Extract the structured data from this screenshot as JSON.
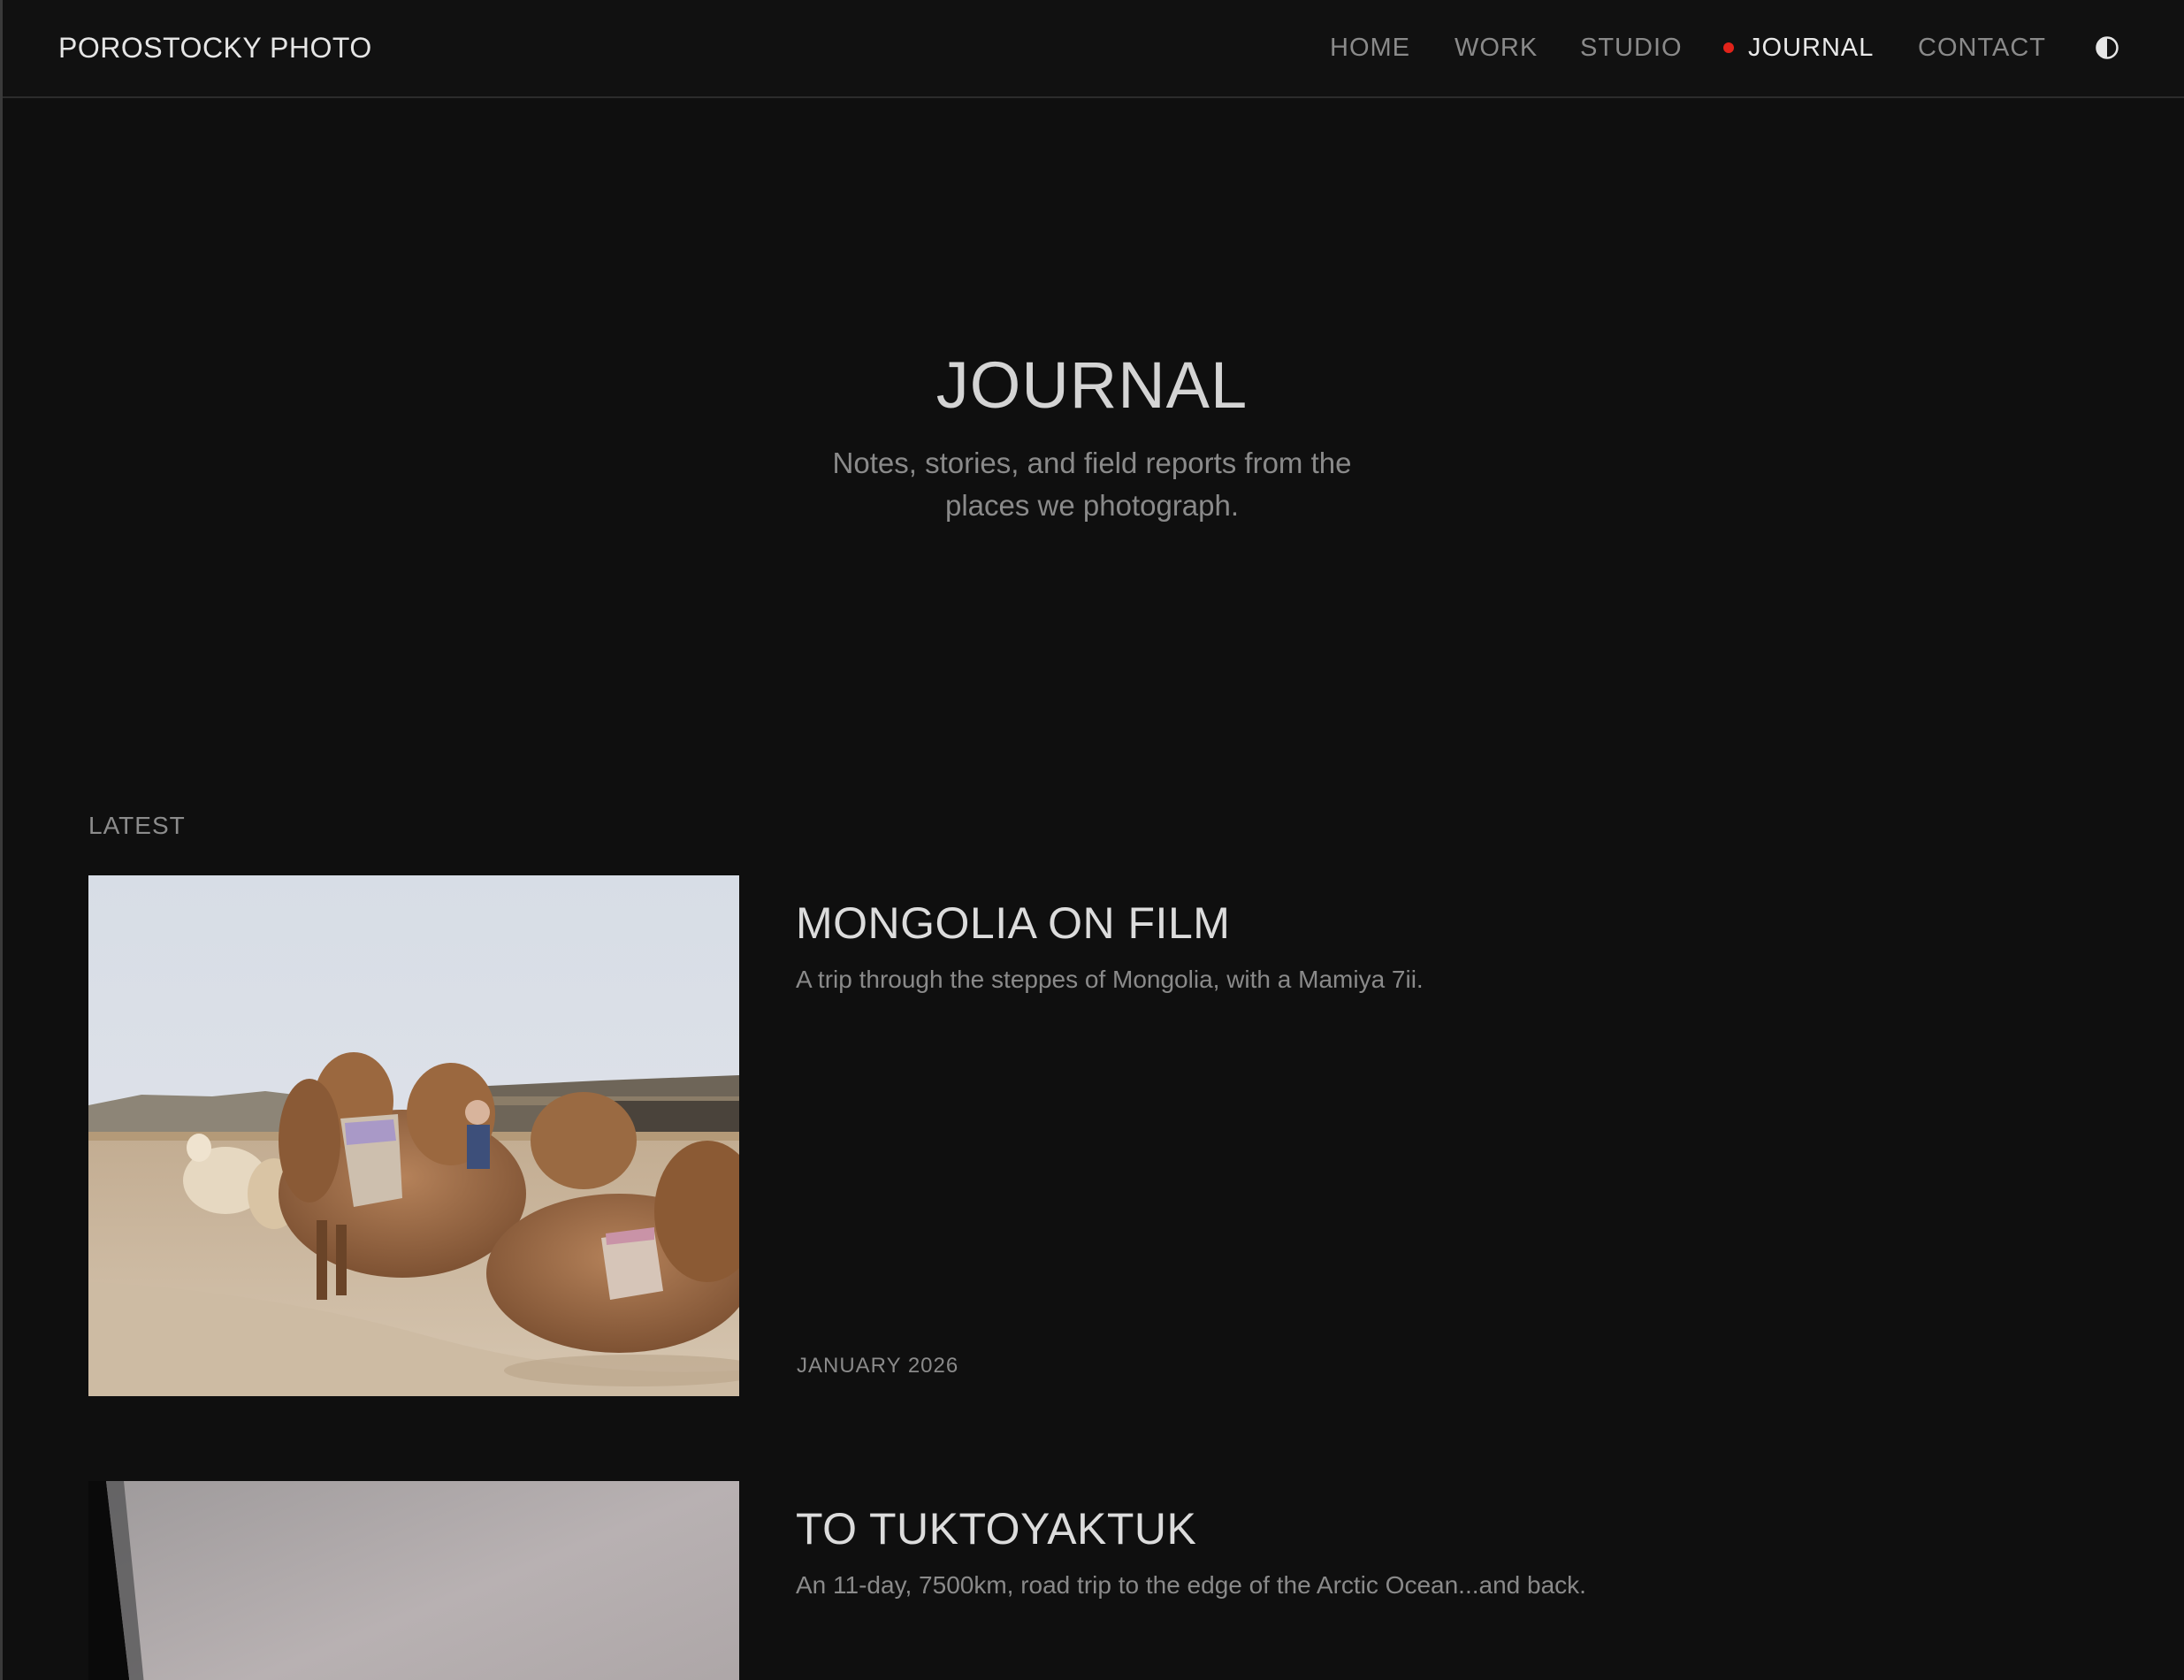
{
  "brand": "POROSTOCKY PHOTO",
  "nav": {
    "items": [
      {
        "label": "HOME",
        "active": false
      },
      {
        "label": "WORK",
        "active": false
      },
      {
        "label": "STUDIO",
        "active": false
      },
      {
        "label": "JOURNAL",
        "active": true
      },
      {
        "label": "CONTACT",
        "active": false
      }
    ],
    "theme_toggle_icon": "contrast-half-circle-icon",
    "active_indicator_color": "#e2231a"
  },
  "hero": {
    "title": "JOURNAL",
    "subtitle": "Notes, stories, and field reports from the places we photograph."
  },
  "section": {
    "label": "LATEST"
  },
  "entries": [
    {
      "title": "MONGOLIA ON FILM",
      "excerpt": "A trip through the steppes of Mongolia, with a Mamiya 7ii.",
      "date": "JANUARY 2026",
      "image_subject": "camels resting in a sandy enclosure"
    },
    {
      "title": "TO TUKTOYAKTUK",
      "excerpt": "An 11-day, 7500km, road trip to the edge of the Arctic Ocean...and back.",
      "image_subject": "grey sky through a vehicle window"
    }
  ]
}
